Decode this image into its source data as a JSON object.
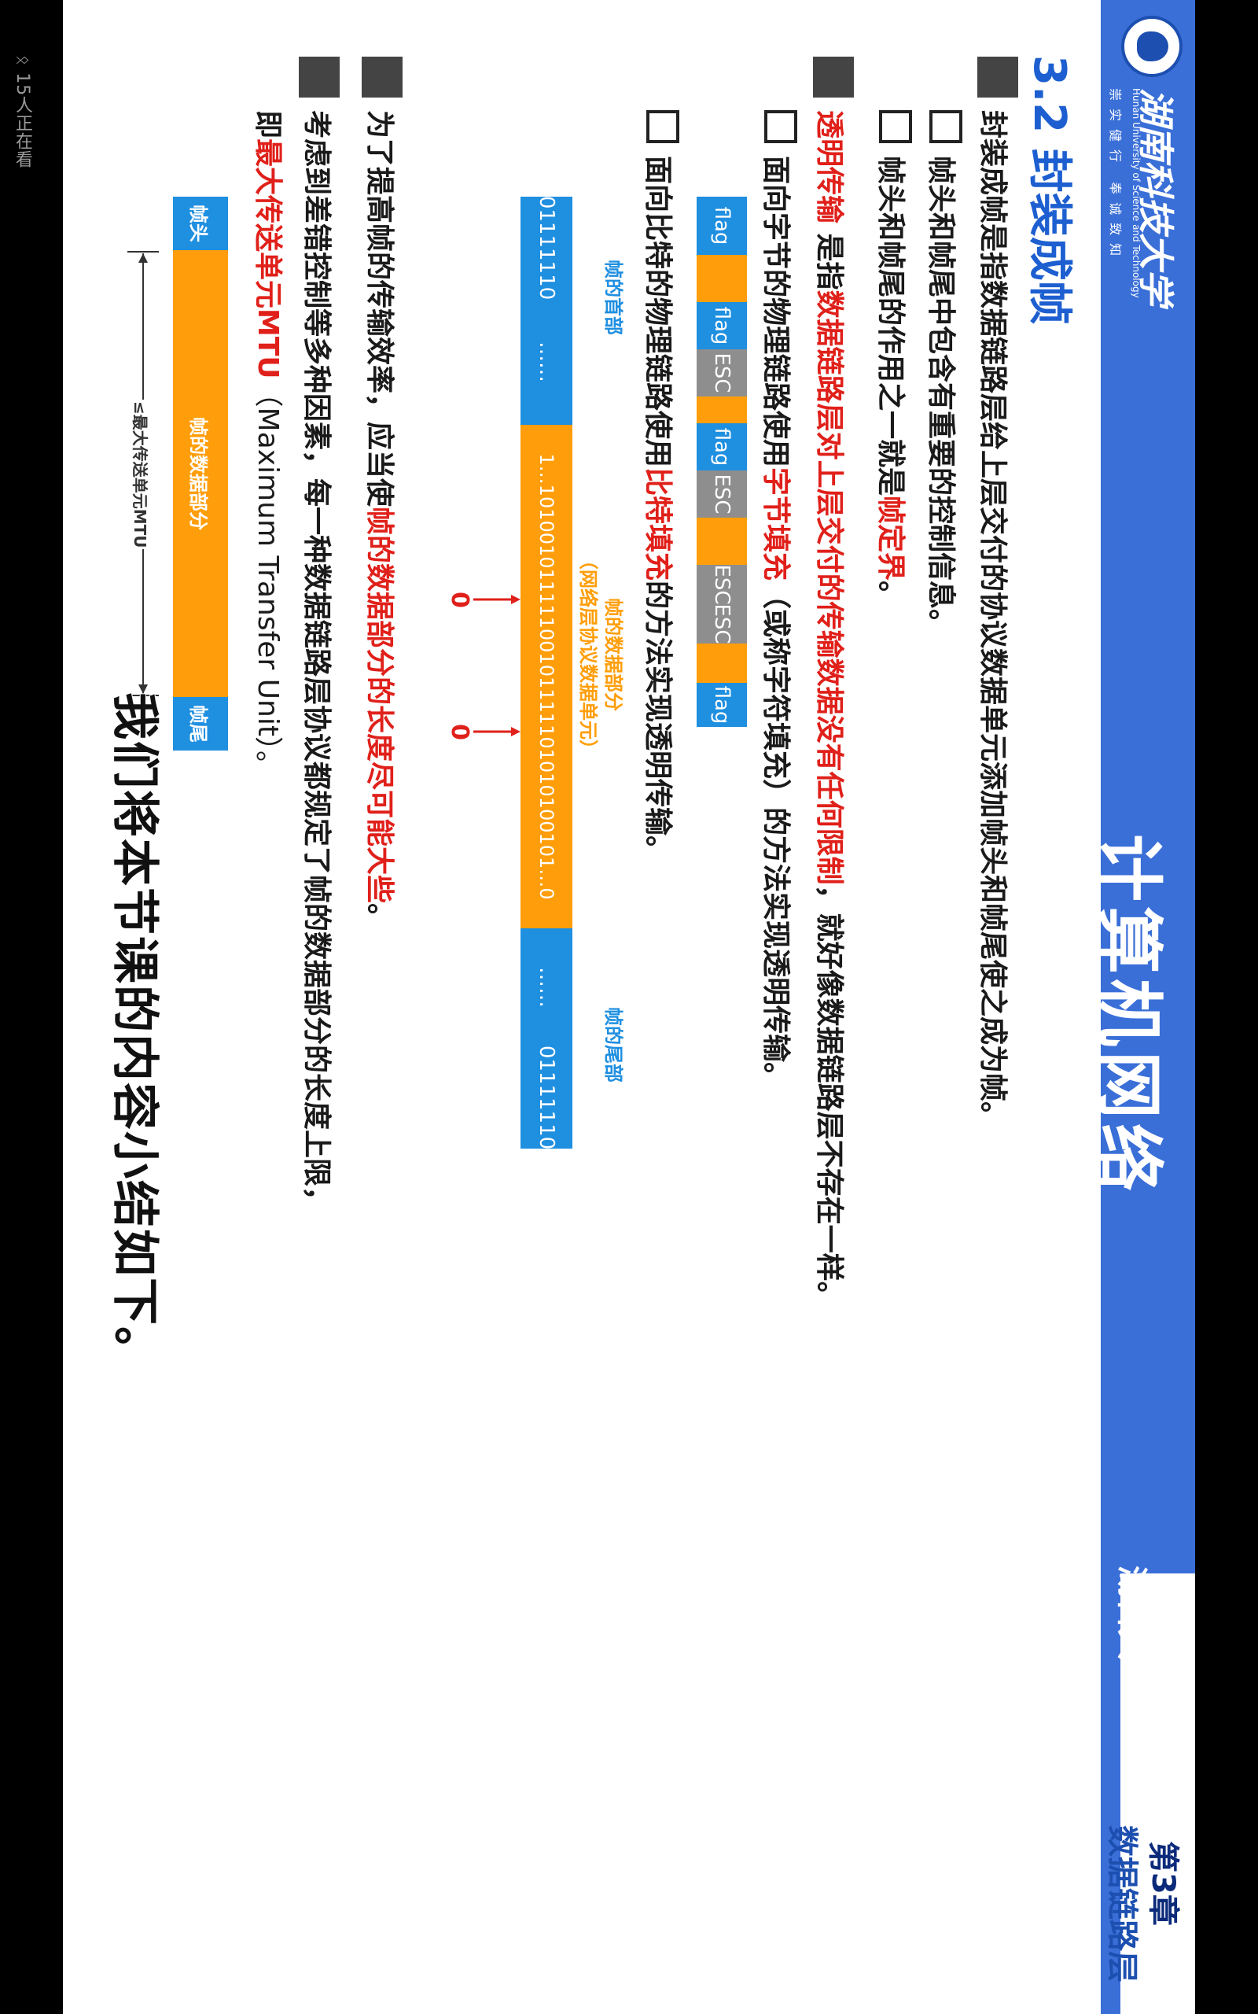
{
  "viewer": {
    "count": "15人正在看"
  },
  "header": {
    "university_cn": "湖南科技大学",
    "university_en": "Hunan University of Science and Technology",
    "motto": "崇实健行 奉诚致知",
    "course_title": "计算机网络",
    "school_name": "湖科大",
    "chapter_no": "第3章",
    "chapter_name": "数据链路层"
  },
  "section": {
    "title": "3.2 封装成帧"
  },
  "bullets": {
    "b1": "封装成帧是指数据链路层给上层交付的协议数据单元添加帧头和帧尾使之成为帧。",
    "b1_1": "帧头和帧尾中包含有重要的控制信息。",
    "b1_2_pre": "帧头和帧尾的作用之一就是",
    "b1_2_red": "帧定界",
    "b1_2_post": "。",
    "b2_red1": "透明传输",
    "b2_mid1": " 是指",
    "b2_red2": "数据链路层对上层交付的传输数据没有任何限制",
    "b2_post": "，就好像数据链路层不存在一样。",
    "b2_1_pre": "面向字节的物理链路使用",
    "b2_1_red": "字节填充",
    "b2_1_post": "（或称字符填充）的方法实现透明传输。",
    "b2_2_pre": "面向比特的物理链路使用",
    "b2_2_red": "比特填充",
    "b2_2_post": "的方法实现透明传输。",
    "b3_pre": "为了提高帧的传输效率，应当使",
    "b3_red": "帧的数据部分的长度尽可能大些",
    "b3_post": "。",
    "b4_line1": "考虑到差错控制等多种因素，每一种数据链路层协议都规定了帧的数据部分的长度上限，",
    "b4_pre": "即",
    "b4_red": "最大传送单元MTU",
    "b4_post": "（Maximum Transfer Unit）。"
  },
  "byte_fig": {
    "cells": [
      "flag",
      "",
      "flag",
      "ESC",
      "",
      "flag",
      "ESC",
      "",
      "ESC",
      "ESC",
      "",
      "flag"
    ]
  },
  "bit_fig": {
    "head_label": "帧的首部",
    "data_label": "帧的数据部分",
    "data_label_sub": "（网络层协议数据单元）",
    "tail_label": "帧的尾部",
    "head_flag": "01111110",
    "head_dots": "……",
    "data_bits": "1…10100101111100101111101010100101…0",
    "tail_dots": "……",
    "tail_flag": "01111110",
    "stuffed_bit_1": "0",
    "stuffed_bit_2": "0"
  },
  "mtu_fig": {
    "head": "帧头",
    "data": "帧的数据部分",
    "tail": "帧尾",
    "mtu_label": "≤最大传送单元MTU"
  },
  "subtitle": "我们将本节课的内容小结如下。",
  "colors": {
    "banner": "#3a6fd8",
    "accent_red": "#e0201a",
    "title_blue": "#1d5fd0",
    "cell_blue": "#1f8fe0",
    "cell_orange": "#ff9e0a",
    "cell_grey": "#8e8e8e"
  }
}
